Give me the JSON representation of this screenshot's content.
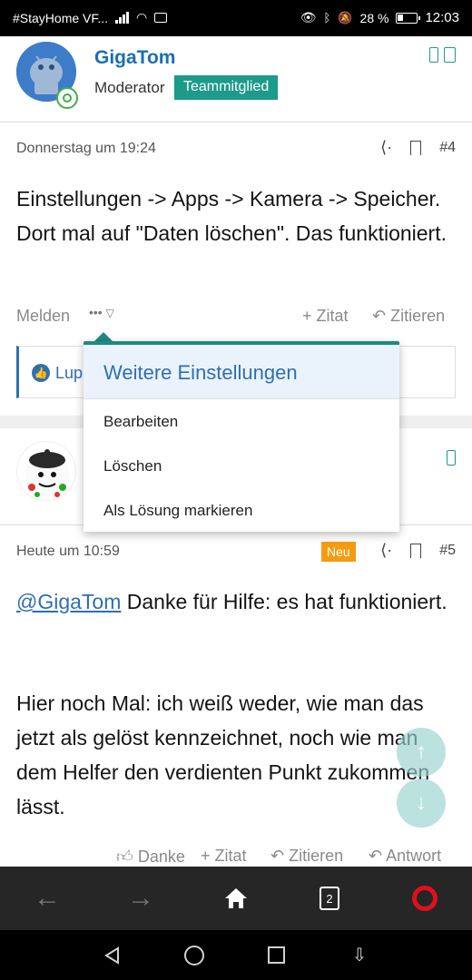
{
  "status_bar": {
    "carrier": "#StayHome VF...",
    "battery": "28 %",
    "time": "12:03"
  },
  "post1": {
    "author": "GigaTom",
    "role": "Moderator",
    "badge": "Teammitglied",
    "timestamp": "Donnerstag um 19:24",
    "number": "#4",
    "text": "Einstellungen -> Apps -> Kamera -> Speicher. Dort mal auf \"Daten löschen\". Das funktioniert.",
    "actions": {
      "report": "Melden",
      "more": "•••",
      "quote_add": "+ Zitat",
      "quote": "Zitieren"
    },
    "reaction_partial": "Lup"
  },
  "dropdown": {
    "title": "Weitere Einstellungen",
    "items": [
      "Bearbeiten",
      "Löschen",
      "Als Lösung markieren"
    ]
  },
  "post2": {
    "timestamp": "Heute um 10:59",
    "new_badge": "Neu",
    "number": "#5",
    "mention": "@GigaTom",
    "text_after_mention": " Danke für Hilfe: es hat funktioniert.",
    "paragraph2": "Hier noch Mal: ich weiß weder, wie man das jetzt als gelöst kennzeichnet, noch wie man dem Helfer den verdienten Punkt zukommen lässt.",
    "actions": {
      "like": "Danke",
      "quote_add": "+ Zitat",
      "quote": "Zitieren",
      "reply": "Antwort"
    }
  },
  "browser": {
    "tab_count": "2"
  },
  "colors": {
    "accent_teal": "#1f8a7f",
    "link_blue": "#2f6fb0",
    "username_blue": "#1a6fb5",
    "new_badge": "#f39c12",
    "opera_red": "#e0101b"
  }
}
